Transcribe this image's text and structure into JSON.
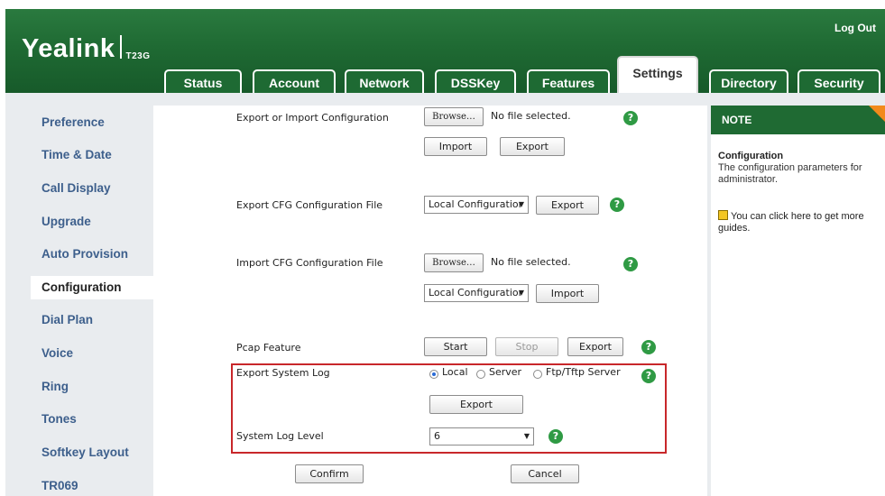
{
  "header": {
    "logout": "Log Out",
    "brand": "Yealink",
    "model": "T23G",
    "tabs": [
      "Status",
      "Account",
      "Network",
      "DSSKey",
      "Features",
      "Settings",
      "Directory",
      "Security"
    ],
    "active_tab": "Settings"
  },
  "sidebar": {
    "items": [
      "Preference",
      "Time & Date",
      "Call Display",
      "Upgrade",
      "Auto Provision",
      "Configuration",
      "Dial Plan",
      "Voice",
      "Ring",
      "Tones",
      "Softkey Layout",
      "TR069"
    ],
    "active": "Configuration"
  },
  "main": {
    "export_import": {
      "label": "Export or Import Configuration",
      "browse": "Browse…",
      "file_status": "No file selected.",
      "import": "Import",
      "export": "Export"
    },
    "export_cfg": {
      "label": "Export CFG Configuration File",
      "select_value": "Local Configuratior",
      "export": "Export"
    },
    "import_cfg": {
      "label": "Import CFG Configuration File",
      "browse": "Browse…",
      "file_status": "No file selected.",
      "select_value": "Local Configuratior",
      "import": "Import"
    },
    "pcap": {
      "label": "Pcap Feature",
      "start": "Start",
      "stop": "Stop",
      "export": "Export"
    },
    "system_log": {
      "label": "Export System Log",
      "options": [
        "Local",
        "Server",
        "Ftp/Tftp Server"
      ],
      "selected": "Local",
      "export": "Export"
    },
    "log_level": {
      "label": "System Log Level",
      "value": "6"
    },
    "confirm": "Confirm",
    "cancel": "Cancel"
  },
  "note": {
    "header": "NOTE",
    "title": "Configuration",
    "text": "The configuration parameters for administrator.",
    "guide": "You can click here to get more guides."
  },
  "colors": {
    "header_green": "#1f6a33",
    "sidebar_link": "#3d5f8c",
    "help_icon": "#2f9a44",
    "highlight_box": "#c8272a",
    "note_corner": "#f28a1c"
  }
}
